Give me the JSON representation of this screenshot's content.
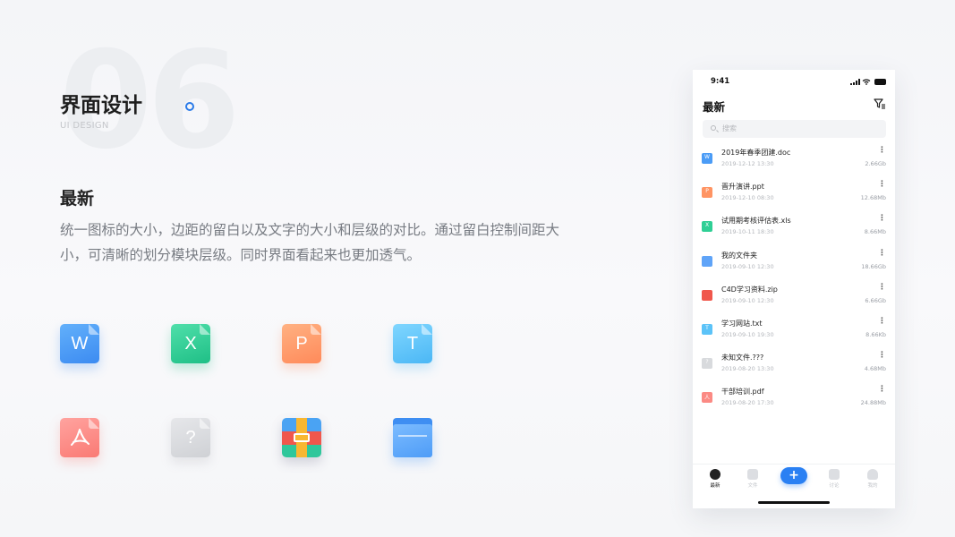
{
  "page": {
    "bg_number": "06",
    "title": "界面设计",
    "subtitle": "UI DESIGN",
    "section_title": "最新",
    "description": "统一图标的大小，边距的留白以及文字的大小和层级的对比。通过留白控制间距大小，可清晰的划分模块层级。同时界面看起来也更加透气。",
    "accent_color": "#2b7be8"
  },
  "icons": [
    {
      "name": "word-file-icon",
      "glyph": "W"
    },
    {
      "name": "excel-file-icon",
      "glyph": "X"
    },
    {
      "name": "ppt-file-icon",
      "glyph": "P"
    },
    {
      "name": "txt-file-icon",
      "glyph": "T"
    },
    {
      "name": "pdf-file-icon",
      "glyph": ""
    },
    {
      "name": "unknown-file-icon",
      "glyph": "?"
    },
    {
      "name": "zip-file-icon",
      "glyph": ""
    },
    {
      "name": "folder-icon",
      "glyph": ""
    }
  ],
  "phone": {
    "time": "9:41",
    "title": "最新",
    "search_placeholder": "搜索",
    "files": [
      {
        "name": "2019年春季团建.doc",
        "date": "2019-12-12 13:30",
        "size": "2.66Gb",
        "type": "word",
        "color": "#4b9cf6",
        "glyph": "W"
      },
      {
        "name": "晋升演讲.ppt",
        "date": "2019-12-10 08:30",
        "size": "12.68Mb",
        "type": "ppt",
        "color": "#ff9463",
        "glyph": "P"
      },
      {
        "name": "试用期考核评估表.xls",
        "date": "2019-10-11 18:30",
        "size": "8.66Mb",
        "type": "excel",
        "color": "#2fcf95",
        "glyph": "X"
      },
      {
        "name": "我的文件夹",
        "date": "2019-09-10 12:30",
        "size": "18.66Gb",
        "type": "folder",
        "color": "#5fa4f8",
        "glyph": ""
      },
      {
        "name": "C4D学习资料.zip",
        "date": "2019-09-10 12:30",
        "size": "6.66Gb",
        "type": "zip",
        "color": "#f0574c",
        "glyph": ""
      },
      {
        "name": "学习网站.txt",
        "date": "2019-09-10 19:30",
        "size": "8.66Kb",
        "type": "txt",
        "color": "#5cc3f8",
        "glyph": "T"
      },
      {
        "name": "未知文件.???",
        "date": "2019-08-20 13:30",
        "size": "4.68Mb",
        "type": "unknown",
        "color": "#d8dadd",
        "glyph": "?"
      },
      {
        "name": "干部培训.pdf",
        "date": "2019-08-20 17:30",
        "size": "24.88Mb",
        "type": "pdf",
        "color": "#fb8a84",
        "glyph": "人"
      }
    ],
    "tabs": [
      {
        "label": "最新",
        "active": true
      },
      {
        "label": "文件",
        "active": false
      },
      {
        "label": "讨论",
        "active": false
      },
      {
        "label": "我的",
        "active": false
      }
    ],
    "add_label": "+"
  }
}
